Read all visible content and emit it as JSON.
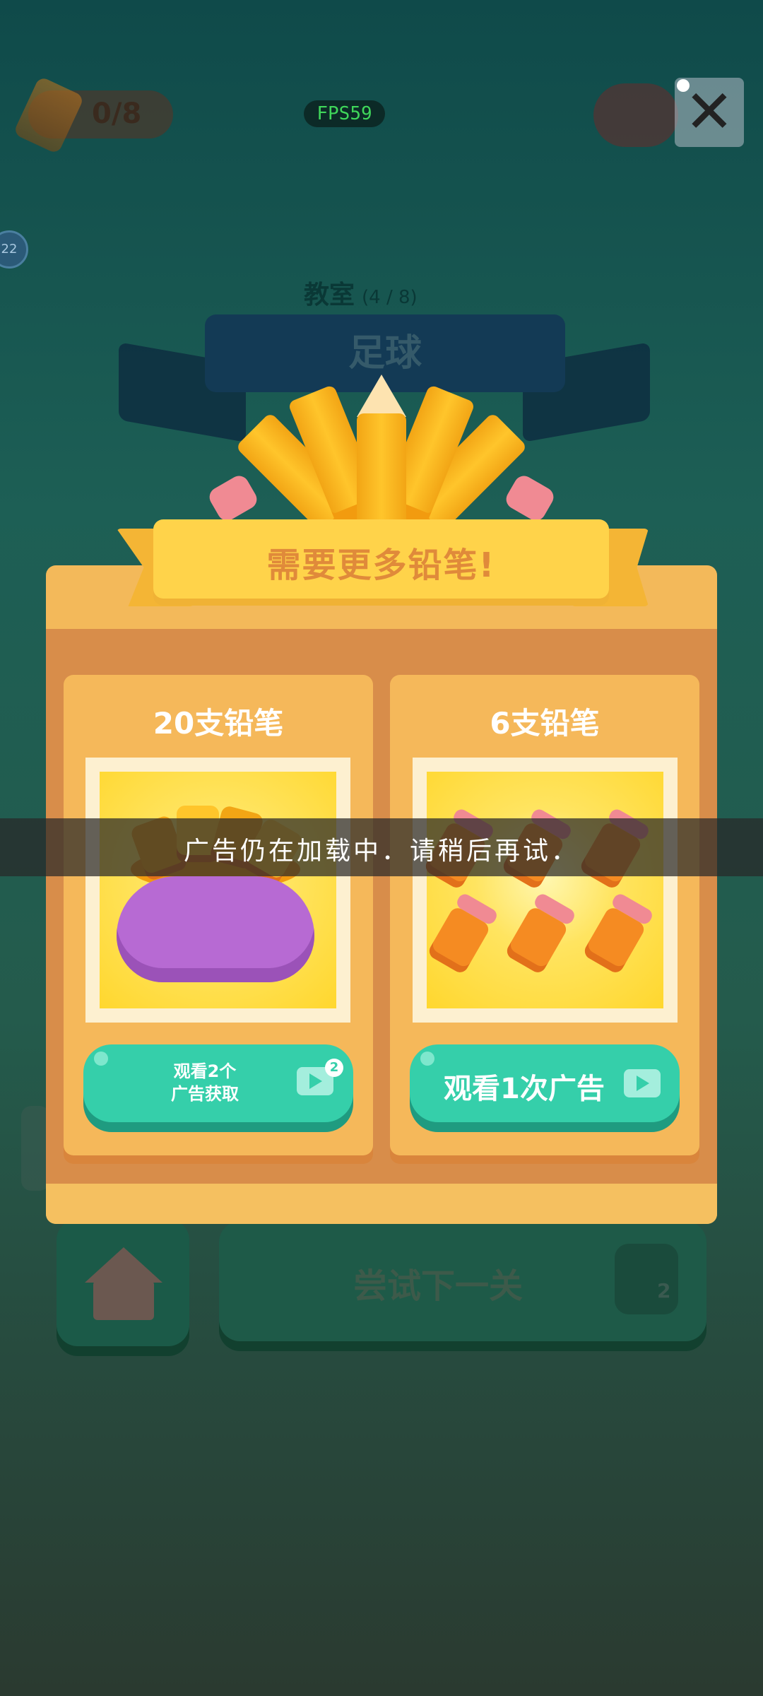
{
  "hud": {
    "pencil_count": "0/8",
    "fps": "FPS59",
    "level_badge": "22"
  },
  "level": {
    "category": "教室",
    "progress": "(4 / 8)",
    "title": "足球"
  },
  "bottom_bar": {
    "next_label": "尝试下一关",
    "next_cost": "2"
  },
  "popup": {
    "title": "需要更多铅笔!",
    "cards": [
      {
        "title": "20支铅笔",
        "button_label_line1": "观看2个",
        "button_label_line2": "广告获取",
        "badge": "2"
      },
      {
        "title": "6支铅笔",
        "button_label": "观看1次广告"
      }
    ]
  },
  "toast": {
    "message": "广告仍在加载中．请稍后再试．"
  },
  "colors": {
    "accent_green": "#35cfaa",
    "popup_orange": "#f3b95a",
    "banner_yellow": "#ffd34a",
    "fps_green": "#3fd65a"
  }
}
